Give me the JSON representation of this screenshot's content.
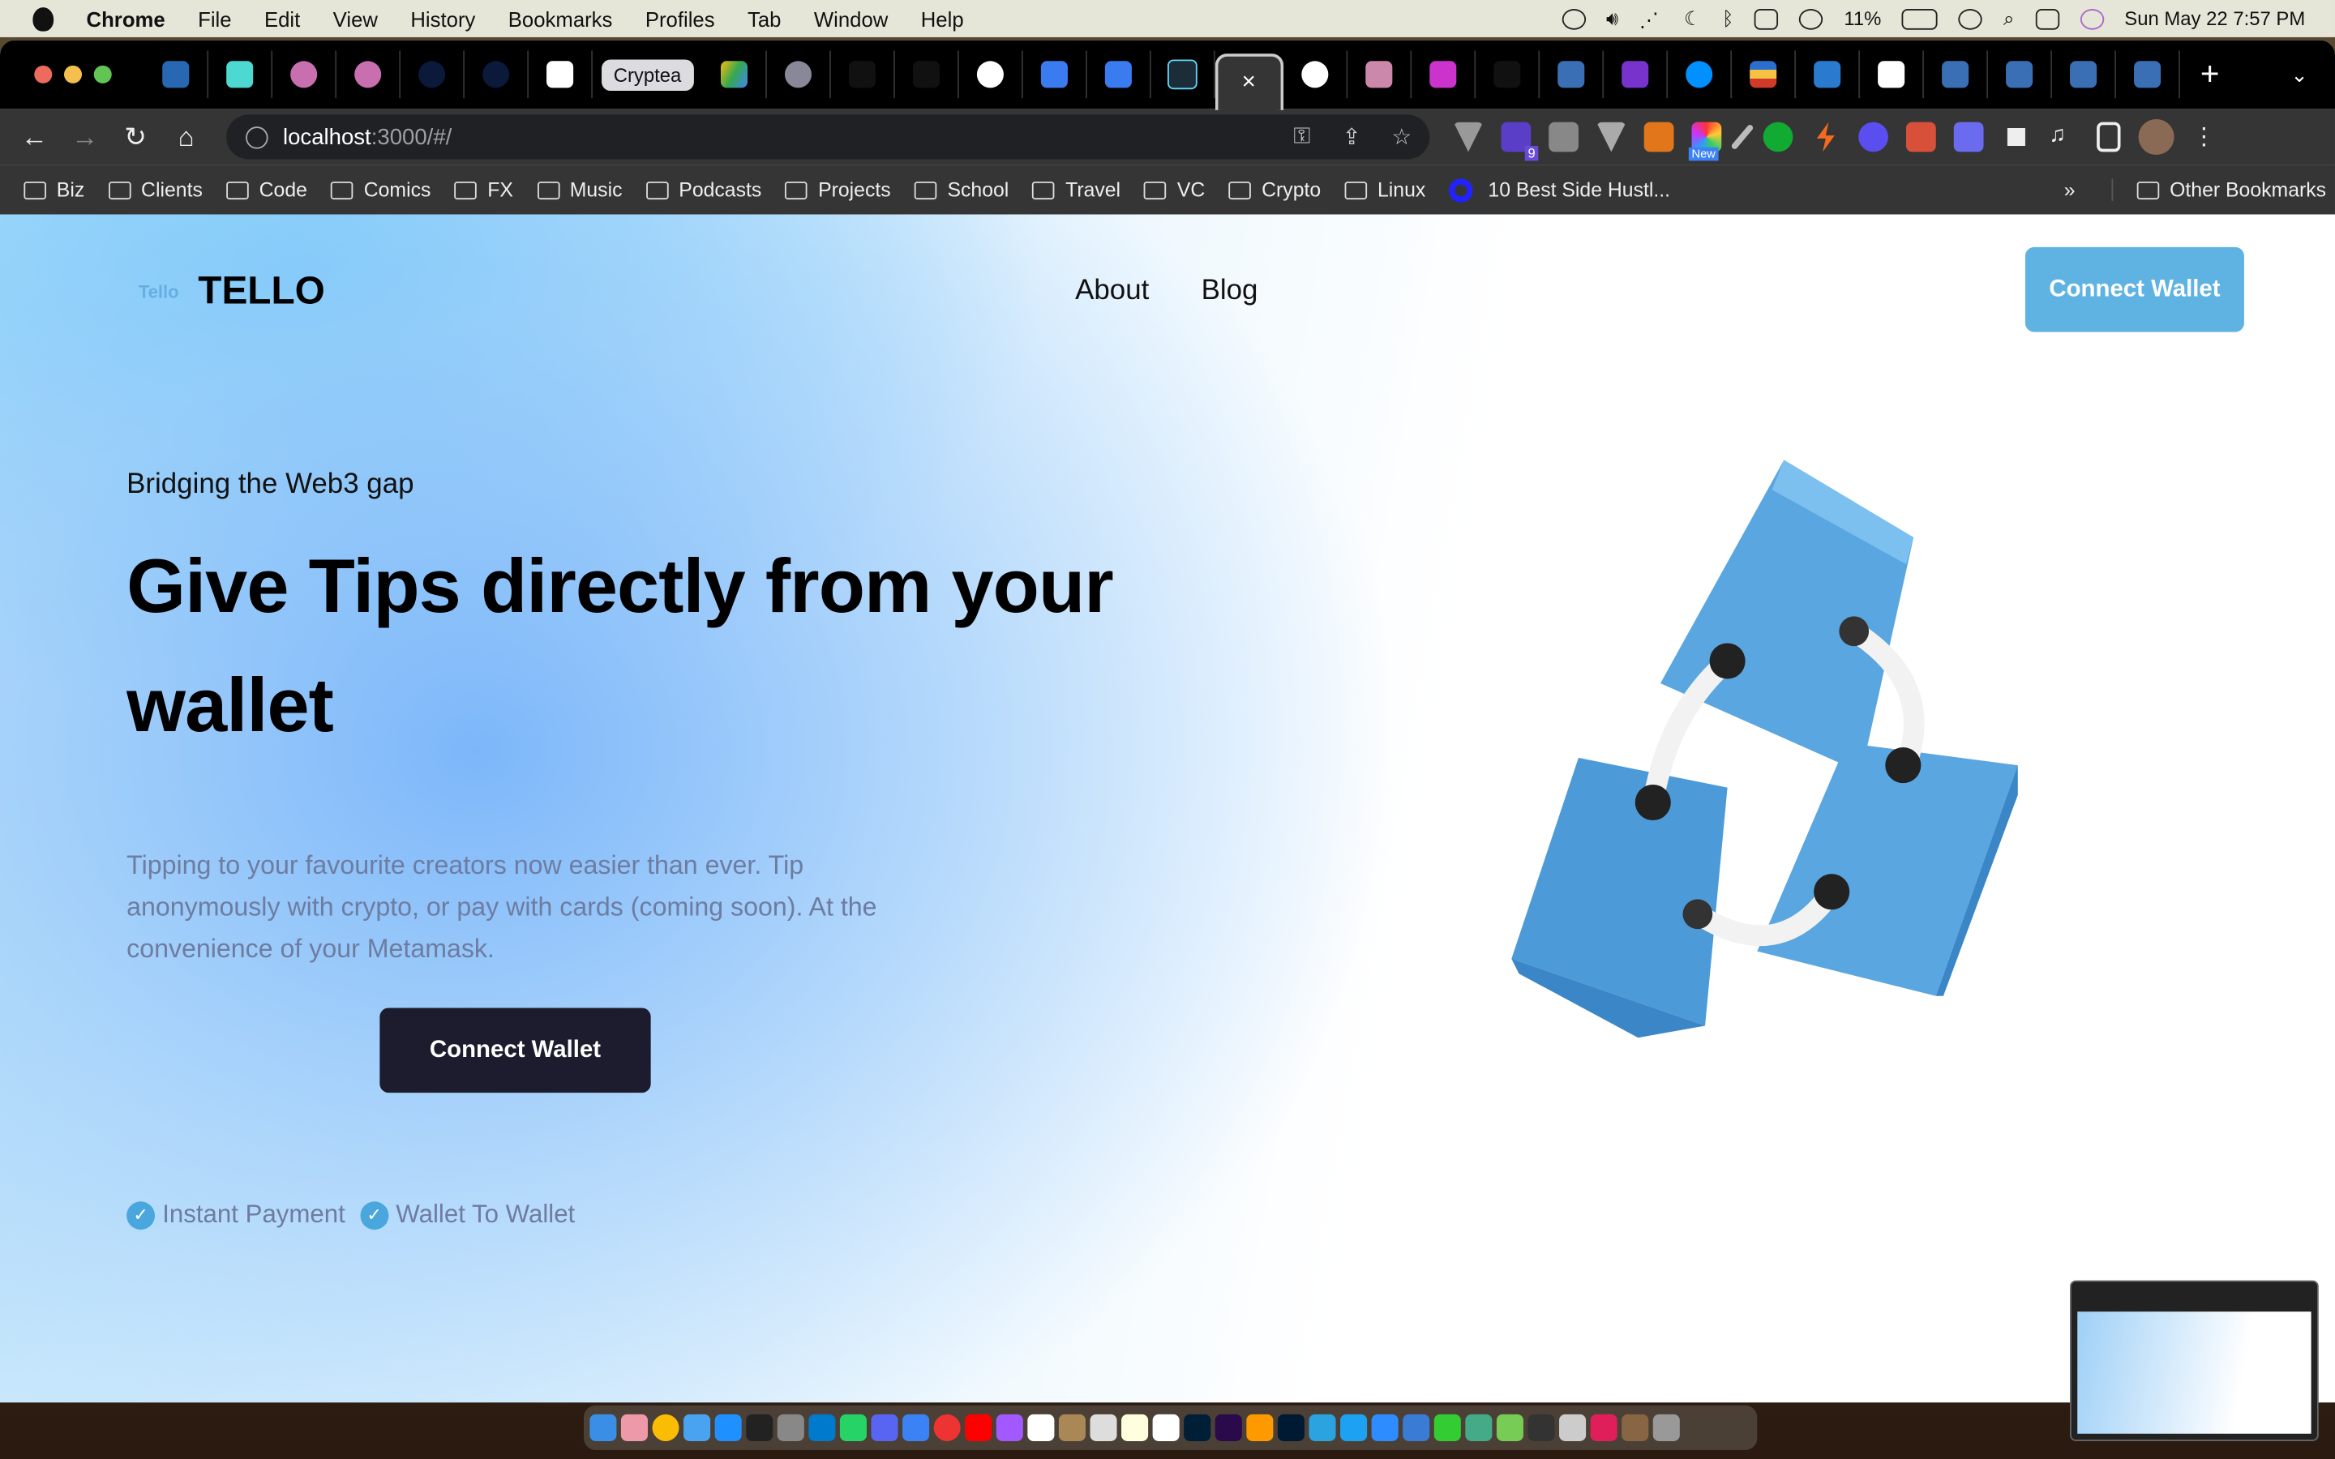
{
  "menubar": {
    "app": "Chrome",
    "items": [
      "File",
      "Edit",
      "View",
      "History",
      "Bookmarks",
      "Profiles",
      "Tab",
      "Window",
      "Help"
    ],
    "battery": "11%",
    "datetime": "Sun May 22  7:57 PM"
  },
  "tabs": {
    "labeled_tab": "Cryptea",
    "active_tab_close": "×",
    "new_tab": "+",
    "tab_menu": "⌄"
  },
  "toolbar": {
    "url_host": "localhost",
    "url_rest": ":3000/#/",
    "extension_badge": "9",
    "extension_new": "New"
  },
  "bookmarks": {
    "items": [
      "Biz",
      "Clients",
      "Code",
      "Comics",
      "FX",
      "Music",
      "Podcasts",
      "Projects",
      "School",
      "Travel",
      "VC",
      "Crypto",
      "Linux"
    ],
    "link": "10 Best Side Hustl...",
    "overflow": "»",
    "other": "Other Bookmarks"
  },
  "site": {
    "logo_small": "Tello",
    "logo": "TELLO",
    "nav": [
      "About",
      "Blog"
    ],
    "connect_top": "Connect Wallet",
    "eyebrow": "Bridging the Web3 gap",
    "headline": "Give Tips directly from your wallet",
    "description": "Tipping to your favourite creators now easier than ever. Tip anonymously with crypto, or pay with cards (coming soon). At the convenience of your Metamask.",
    "connect_main": "Connect Wallet",
    "features": [
      "Instant Payment",
      "Wallet To Wallet"
    ],
    "accent": "#5fb3e2",
    "dark_button": "#1c1c2e"
  }
}
